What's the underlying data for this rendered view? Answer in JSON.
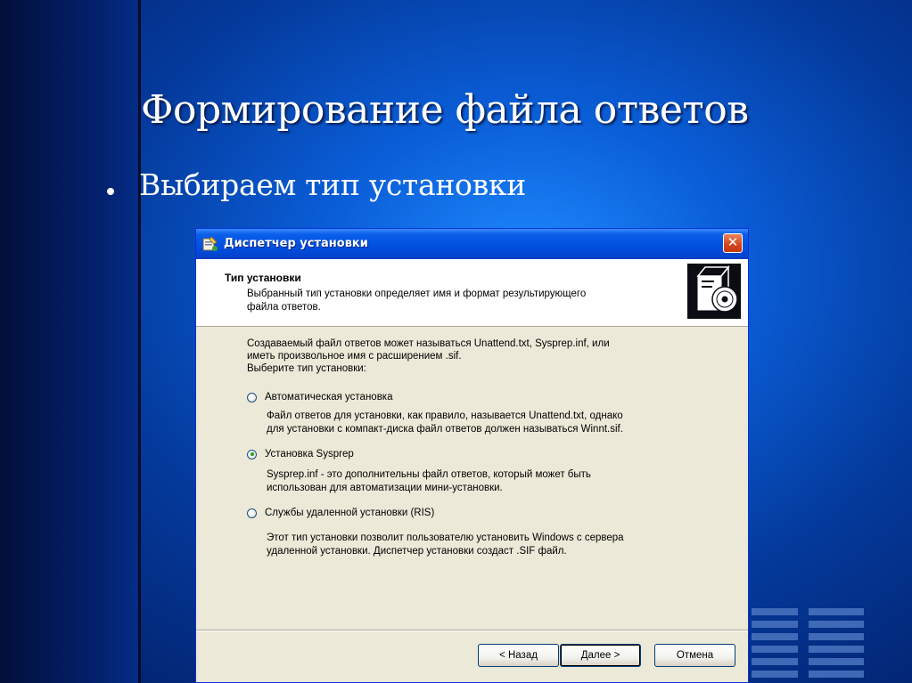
{
  "slide": {
    "title": "Формирование файла ответов",
    "bullet": "Выбираем тип установки"
  },
  "window": {
    "title": "Диспетчер установки",
    "close_label": "✕",
    "header": {
      "title": "Тип установки",
      "desc_line1": "Выбранный тип установки определяет имя и формат результирующего",
      "desc_line2": "файла ответов."
    },
    "intro_line1": "Создаваемый файл ответов может называться Unattend.txt, Sysprep.inf, или",
    "intro_line2": "иметь произвольное имя с расширением .sif.",
    "intro_line3": "Выберите тип установки:",
    "options": [
      {
        "label": "Автоматическая установка",
        "checked": false,
        "desc_line1": "Файл ответов для установки, как правило, называется Unattend.txt, однако",
        "desc_line2": "для установки с компакт-диска файл ответов должен называться Winnt.sif."
      },
      {
        "label": "Установка Sysprep",
        "checked": true,
        "desc_line1": "Sysprep.inf - это дополнительны файл ответов, который может быть",
        "desc_line2": "использован для автоматизации мини-установки."
      },
      {
        "label": "Службы удаленной установки (RIS)",
        "checked": false,
        "desc_line1": "Этот тип установки позволит пользователю установить Windows с сервера",
        "desc_line2": "удаленной установки. Диспетчер установки создаст .SIF файл."
      }
    ],
    "buttons": {
      "back": "< Назад",
      "next": "Далее >",
      "cancel": "Отмена"
    }
  },
  "colors": {
    "background": "#0a5ed8",
    "titlebar": "#0250e0",
    "dialog_face": "#ece9d8",
    "radio_dot": "#21a121"
  },
  "icons": {
    "app": "wizard-app-icon",
    "header": "cd-box-icon",
    "close": "close-icon"
  }
}
